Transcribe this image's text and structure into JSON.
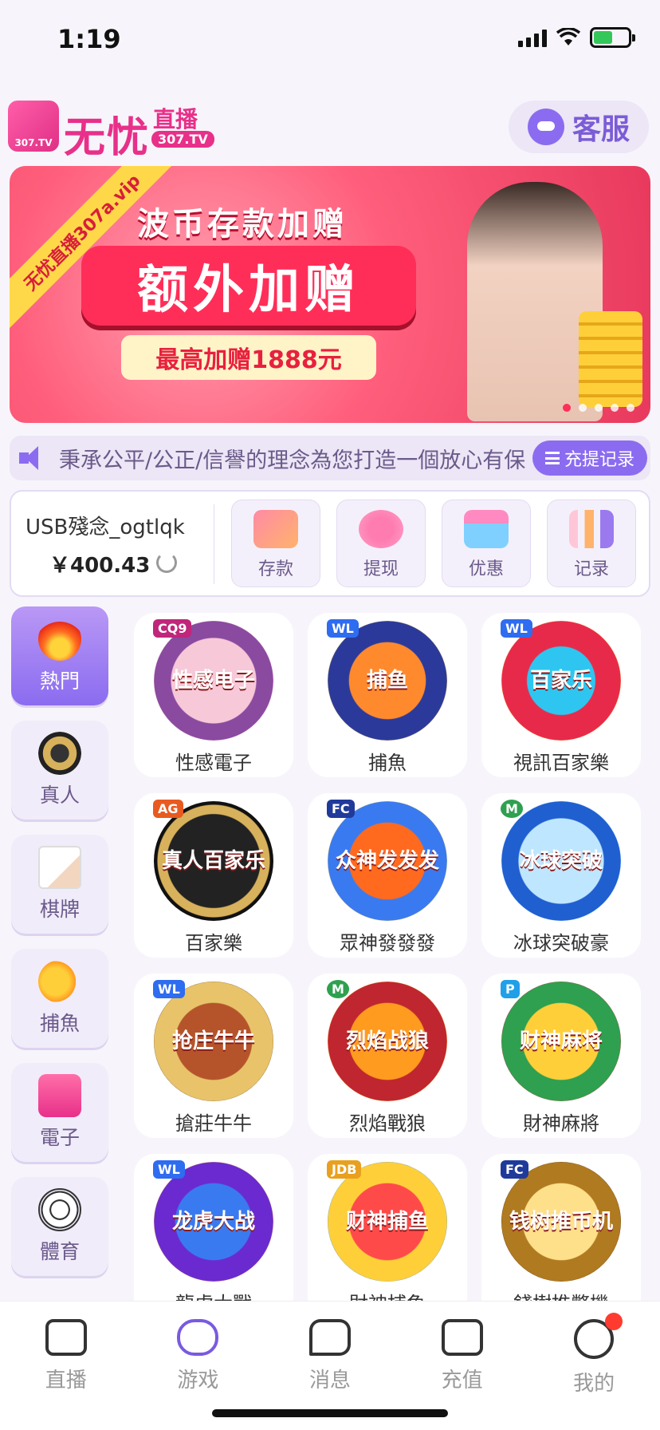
{
  "status": {
    "time": "1:19"
  },
  "header": {
    "logo_badge": "307.TV",
    "logo_title": "无忧",
    "logo_sub": "直播",
    "logo_sub_badge": "307.TV",
    "service_label": "客服"
  },
  "banner": {
    "stripe_text": "无忧直播307a.vip",
    "title": "波币存款加赠",
    "main": "额外加赠",
    "sub": "最高加赠1888元",
    "dots": 5,
    "active_dot": 0
  },
  "marquee": {
    "text": "秉承公平/公正/信譽的理念為您打造一個放心有保",
    "record_label": "充提记录"
  },
  "wallet": {
    "username": "USB殘念_ogtlqk",
    "balance": "￥400.43",
    "actions": [
      {
        "label": "存款",
        "icon": "card-icon"
      },
      {
        "label": "提现",
        "icon": "money-bag-icon"
      },
      {
        "label": "优惠",
        "icon": "gift-icon"
      },
      {
        "label": "记录",
        "icon": "chart-icon"
      }
    ]
  },
  "categories": [
    {
      "label": "熱門",
      "icon": "fire-icon",
      "active": true
    },
    {
      "label": "真人",
      "icon": "casino-chip-icon",
      "active": false
    },
    {
      "label": "棋牌",
      "icon": "poker-card-icon",
      "active": false
    },
    {
      "label": "捕魚",
      "icon": "fish-icon",
      "active": false
    },
    {
      "label": "電子",
      "icon": "slot-machine-icon",
      "active": false
    },
    {
      "label": "體育",
      "icon": "soccer-ball-icon",
      "active": false
    }
  ],
  "games": [
    {
      "name": "性感電子",
      "tag": "CQ9",
      "art_text": "性感电子"
    },
    {
      "name": "捕魚",
      "tag": "WL",
      "art_text": "捕鱼"
    },
    {
      "name": "視訊百家樂",
      "tag": "WL",
      "art_text": "百家乐"
    },
    {
      "name": "百家樂",
      "tag": "AG",
      "art_text": "真人百家乐"
    },
    {
      "name": "眾神發發發",
      "tag": "FC",
      "art_text": "众神发发发"
    },
    {
      "name": "冰球突破豪",
      "tag": "M",
      "art_text": "冰球突破"
    },
    {
      "name": "搶莊牛牛",
      "tag": "WL",
      "art_text": "抢庄牛牛"
    },
    {
      "name": "烈焰戰狼",
      "tag": "M",
      "art_text": "烈焰战狼"
    },
    {
      "name": "財神麻將",
      "tag": "P",
      "art_text": "财神麻将"
    },
    {
      "name": "龍虎大戰",
      "tag": "WL",
      "art_text": "龙虎大战"
    },
    {
      "name": "財神捕魚",
      "tag": "JDB",
      "art_text": "财神捕鱼"
    },
    {
      "name": "錢樹推幣機",
      "tag": "FC",
      "art_text": "钱树推币机"
    }
  ],
  "tabs": [
    {
      "label": "直播",
      "icon": "camera-icon"
    },
    {
      "label": "游戏",
      "icon": "gamepad-icon"
    },
    {
      "label": "消息",
      "icon": "message-icon"
    },
    {
      "label": "充值",
      "icon": "wallet-icon"
    },
    {
      "label": "我的",
      "icon": "profile-icon",
      "badge": true
    }
  ],
  "colors": {
    "accent": "#8b6cf0",
    "brand_pink": "#e8308a",
    "notification": "#ff3b30"
  }
}
